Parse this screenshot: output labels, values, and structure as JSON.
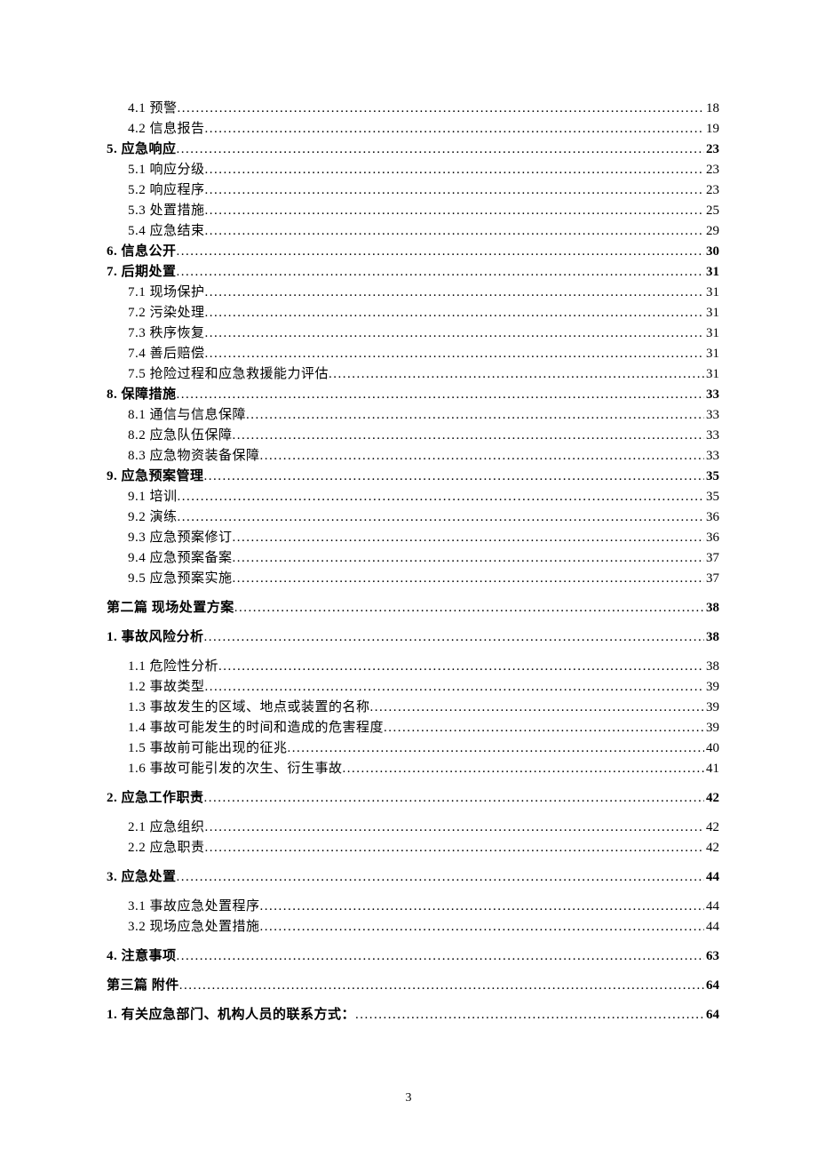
{
  "toc": [
    {
      "label": "4.1 预警",
      "page": "18",
      "level": 1,
      "bold": false,
      "gap": false
    },
    {
      "label": "4.2 信息报告",
      "page": "19",
      "level": 1,
      "bold": false,
      "gap": false
    },
    {
      "label": "5. 应急响应",
      "page": "23",
      "level": 0,
      "bold": true,
      "gap": false
    },
    {
      "label": "5.1 响应分级",
      "page": "23",
      "level": 1,
      "bold": false,
      "gap": false
    },
    {
      "label": "5.2 响应程序",
      "page": "23",
      "level": 1,
      "bold": false,
      "gap": false
    },
    {
      "label": "5.3 处置措施",
      "page": "25",
      "level": 1,
      "bold": false,
      "gap": false
    },
    {
      "label": "5.4 应急结束",
      "page": "29",
      "level": 1,
      "bold": false,
      "gap": false
    },
    {
      "label": "6. 信息公开",
      "page": "30",
      "level": 0,
      "bold": true,
      "gap": false
    },
    {
      "label": "7. 后期处置",
      "page": "31",
      "level": 0,
      "bold": true,
      "gap": false
    },
    {
      "label": "7.1 现场保护",
      "page": "31",
      "level": 1,
      "bold": false,
      "gap": false
    },
    {
      "label": "7.2 污染处理",
      "page": "31",
      "level": 1,
      "bold": false,
      "gap": false
    },
    {
      "label": "7.3 秩序恢复",
      "page": "31",
      "level": 1,
      "bold": false,
      "gap": false
    },
    {
      "label": "7.4 善后赔偿",
      "page": "31",
      "level": 1,
      "bold": false,
      "gap": false
    },
    {
      "label": "7.5 抢险过程和应急救援能力评估",
      "page": "31",
      "level": 1,
      "bold": false,
      "gap": false
    },
    {
      "label": "8. 保障措施",
      "page": "33",
      "level": 0,
      "bold": true,
      "gap": false
    },
    {
      "label": "8.1 通信与信息保障",
      "page": "33",
      "level": 1,
      "bold": false,
      "gap": false
    },
    {
      "label": "8.2 应急队伍保障",
      "page": "33",
      "level": 1,
      "bold": false,
      "gap": false
    },
    {
      "label": "8.3 应急物资装备保障",
      "page": "33",
      "level": 1,
      "bold": false,
      "gap": false
    },
    {
      "label": "9. 应急预案管理",
      "page": "35",
      "level": 0,
      "bold": true,
      "gap": false
    },
    {
      "label": "9.1 培训",
      "page": "35",
      "level": 1,
      "bold": false,
      "gap": false
    },
    {
      "label": "9.2 演练",
      "page": "36",
      "level": 1,
      "bold": false,
      "gap": false
    },
    {
      "label": "9.3 应急预案修订",
      "page": "36",
      "level": 1,
      "bold": false,
      "gap": false
    },
    {
      "label": "9.4 应急预案备案",
      "page": "37",
      "level": 1,
      "bold": false,
      "gap": false
    },
    {
      "label": "9.5 应急预案实施",
      "page": "37",
      "level": 1,
      "bold": false,
      "gap": false
    },
    {
      "label": "第二篇  现场处置方案",
      "page": "38",
      "level": 0,
      "bold": true,
      "gap": true
    },
    {
      "label": "1. 事故风险分析",
      "page": "38",
      "level": 0,
      "bold": true,
      "gap": true
    },
    {
      "label": "1.1 危险性分析",
      "page": "38",
      "level": 1,
      "bold": false,
      "gap": true
    },
    {
      "label": "1.2 事故类型",
      "page": "39",
      "level": 1,
      "bold": false,
      "gap": false
    },
    {
      "label": "1.3 事故发生的区域、地点或装置的名称",
      "page": "39",
      "level": 1,
      "bold": false,
      "gap": false
    },
    {
      "label": "1.4 事故可能发生的时间和造成的危害程度",
      "page": "39",
      "level": 1,
      "bold": false,
      "gap": false
    },
    {
      "label": "1.5 事故前可能出现的征兆",
      "page": "40",
      "level": 1,
      "bold": false,
      "gap": false
    },
    {
      "label": "1.6 事故可能引发的次生、衍生事故",
      "page": "41",
      "level": 1,
      "bold": false,
      "gap": false
    },
    {
      "label": "2. 应急工作职责",
      "page": "42",
      "level": 0,
      "bold": true,
      "gap": true
    },
    {
      "label": "2.1 应急组织",
      "page": "42",
      "level": 1,
      "bold": false,
      "gap": true
    },
    {
      "label": "2.2 应急职责",
      "page": "42",
      "level": 1,
      "bold": false,
      "gap": false
    },
    {
      "label": "3. 应急处置",
      "page": "44",
      "level": 0,
      "bold": true,
      "gap": true
    },
    {
      "label": "3.1 事故应急处置程序",
      "page": "44",
      "level": 1,
      "bold": false,
      "gap": true
    },
    {
      "label": "3.2 现场应急处置措施",
      "page": "44",
      "level": 1,
      "bold": false,
      "gap": false
    },
    {
      "label": "4. 注意事项",
      "page": "63",
      "level": 0,
      "bold": true,
      "gap": true
    },
    {
      "label": "第三篇  附件",
      "page": "64",
      "level": 0,
      "bold": true,
      "gap": true
    },
    {
      "label": "1.  有关应急部门、机构人员的联系方式：",
      "page": "64",
      "level": 0,
      "bold": true,
      "gap": true
    }
  ],
  "footer_page_number": "3"
}
